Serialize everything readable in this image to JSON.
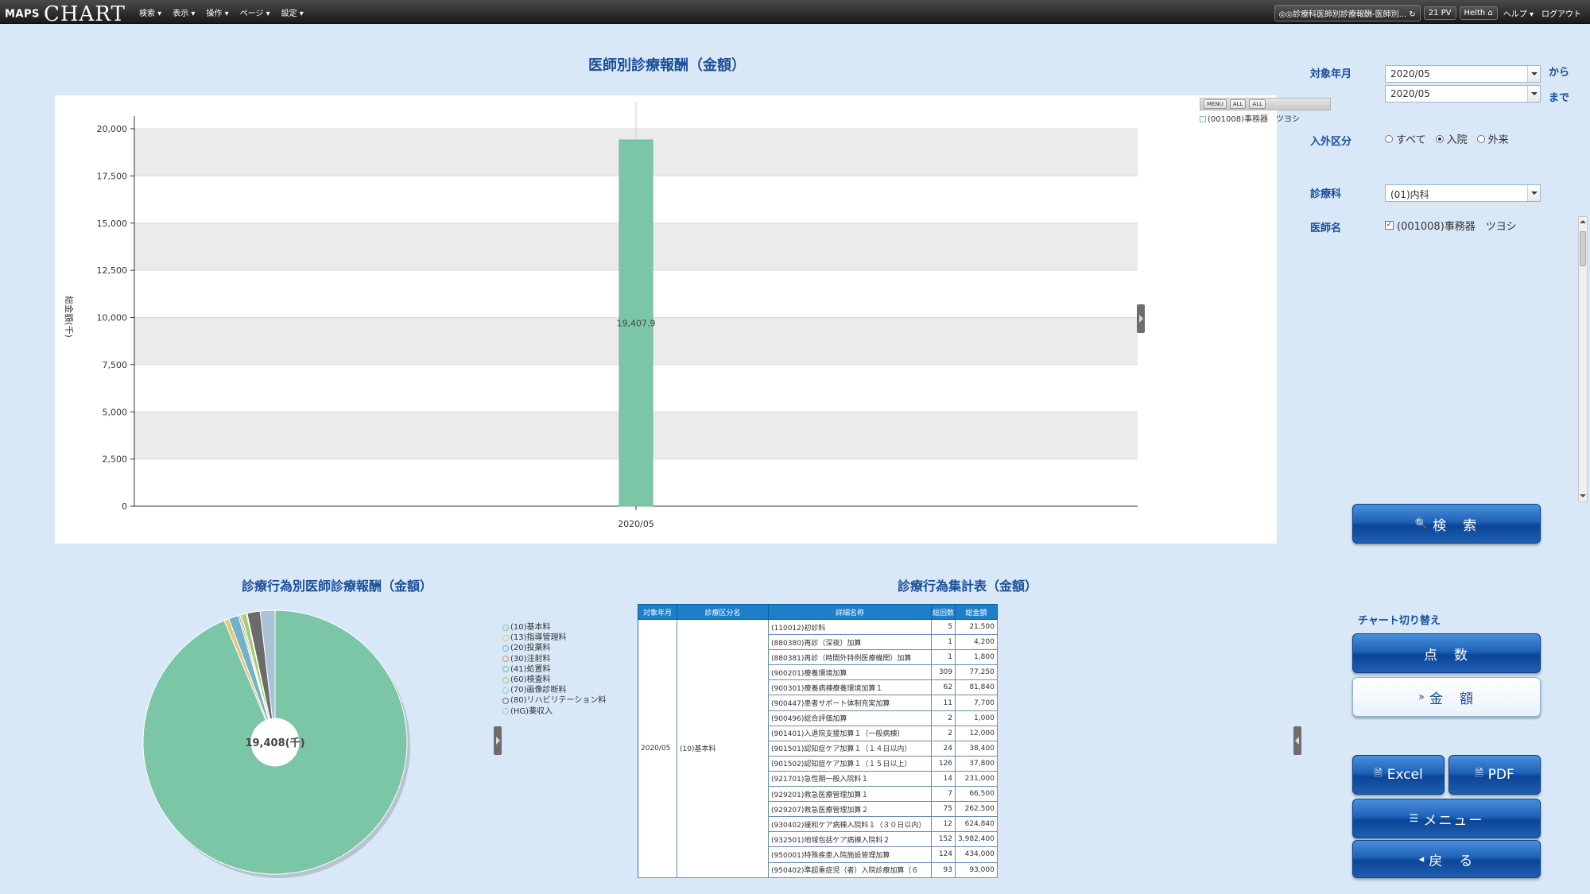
{
  "topbar": {
    "logo_maps": "MAPS",
    "logo_chart": "CHART",
    "menu": [
      "検索 ▾",
      "表示 ▾",
      "操作 ▾",
      "ページ ▾",
      "設定 ▾"
    ],
    "page_path": "◎◎診療科医師別診療報酬-医師別...",
    "pv": "21 PV",
    "user": "Helth",
    "help": "ヘルプ ▾",
    "logout": "ログアウト"
  },
  "main_chart": {
    "title": "医師別診療報酬（金額）",
    "ylabel": "総金額(千)",
    "toolbar": [
      "MENU",
      "ALL",
      "ALL"
    ],
    "legend_item": "(001008)事務器　ツヨシ"
  },
  "chart_data": [
    {
      "type": "bar",
      "title": "医師別診療報酬（金額）",
      "xlabel": "",
      "ylabel": "総金額(千)",
      "categories": [
        "2020/05"
      ],
      "series": [
        {
          "name": "(001008)事務器　ツヨシ",
          "values": [
            19407.9
          ]
        }
      ],
      "data_labels": [
        "19,407.9"
      ],
      "ylim": [
        0,
        20000
      ],
      "yticks": [
        "0",
        "2,500",
        "5,000",
        "7,500",
        "10,000",
        "12,500",
        "15,000",
        "17,500",
        "20,000"
      ],
      "grid": true,
      "legend": "top-right",
      "color": "#7cc6a8"
    },
    {
      "type": "pie",
      "title": "診療行為別医師診療報酬（金額）",
      "center_label": "19,408(千)",
      "slices": [
        {
          "name": "(10)基本料",
          "value": 93.7,
          "color": "#7cc6a8"
        },
        {
          "name": "(13)指導管理料",
          "value": 0.6,
          "color": "#e6c77a"
        },
        {
          "name": "(20)投薬料",
          "value": 1.2,
          "color": "#6fb2c9"
        },
        {
          "name": "(30)注射料",
          "value": 0.2,
          "color": "#e38c7c"
        },
        {
          "name": "(41)処置料",
          "value": 0.2,
          "color": "#7fb8a5"
        },
        {
          "name": "(60)検査料",
          "value": 0.6,
          "color": "#9fcf6e"
        },
        {
          "name": "(70)画像診断料",
          "value": 0.1,
          "color": "#8dd2d8"
        },
        {
          "name": "(80)リハビリテーション料",
          "value": 1.6,
          "color": "#6b6b6b"
        },
        {
          "name": "(HG)薬収入",
          "value": 1.8,
          "color": "#a9c2d6"
        }
      ]
    }
  ],
  "form": {
    "period_label": "対象年月",
    "period_from": "2020/05",
    "period_to": "2020/05",
    "from_word": "から",
    "to_word": "まで",
    "inout_label": "入外区分",
    "inout_options": [
      "すべて",
      "入院",
      "外来"
    ],
    "inout_selected": "入院",
    "dept_label": "診療科",
    "dept_value": "(01)内科",
    "doctor_label": "医師名",
    "doctor_value": "(001008)事務器　ツヨシ",
    "doctor_checked": "✓"
  },
  "buttons": {
    "search": "検　索",
    "chart_switch_label": "チャート切り替え",
    "points": "点　数",
    "amount": "金　額",
    "excel": "Excel",
    "pdf": "PDF",
    "menu": "メニュー",
    "back": "戻　る"
  },
  "pie_section": {
    "title": "診療行為別医師診療報酬（金額）"
  },
  "table_section": {
    "title": "診療行為集計表（金額）",
    "headers": [
      "対象年月",
      "診療区分名",
      "詳細名称",
      "総回数",
      "総金額"
    ],
    "month": "2020/05",
    "category": "(10)基本料",
    "rows": [
      {
        "name": "(110012)初診料",
        "count": "5",
        "amount": "21,500"
      },
      {
        "name": "(880380)再診（深夜）加算",
        "count": "1",
        "amount": "4,200"
      },
      {
        "name": "(880381)再診（時間外特例医療機関）加算",
        "count": "1",
        "amount": "1,800"
      },
      {
        "name": "(900201)療養環境加算",
        "count": "309",
        "amount": "77,250"
      },
      {
        "name": "(900301)療養病棟療養環境加算１",
        "count": "62",
        "amount": "81,840"
      },
      {
        "name": "(900447)患者サポート体制充実加算",
        "count": "11",
        "amount": "7,700"
      },
      {
        "name": "(900496)総合評価加算",
        "count": "2",
        "amount": "1,000"
      },
      {
        "name": "(901401)入退院支援加算１（一般病棟）",
        "count": "2",
        "amount": "12,000"
      },
      {
        "name": "(901501)認知症ケア加算１（１４日以内）",
        "count": "24",
        "amount": "38,400"
      },
      {
        "name": "(901502)認知症ケア加算１（１５日以上）",
        "count": "126",
        "amount": "37,800"
      },
      {
        "name": "(921701)急性期一般入院料１",
        "count": "14",
        "amount": "231,000"
      },
      {
        "name": "(929201)救急医療管理加算１",
        "count": "7",
        "amount": "66,500"
      },
      {
        "name": "(929207)救急医療管理加算２",
        "count": "75",
        "amount": "262,500"
      },
      {
        "name": "(930402)緩和ケア病棟入院料１（３０日以内）",
        "count": "12",
        "amount": "624,840"
      },
      {
        "name": "(932501)地域包括ケア病棟入院料２",
        "count": "152",
        "amount": "3,982,400"
      },
      {
        "name": "(950001)特殊疾患入院施設管理加算",
        "count": "124",
        "amount": "434,000"
      },
      {
        "name": "(950402)準超重症児（者）入院診療加算（６",
        "count": "93",
        "amount": "93,000"
      }
    ]
  }
}
